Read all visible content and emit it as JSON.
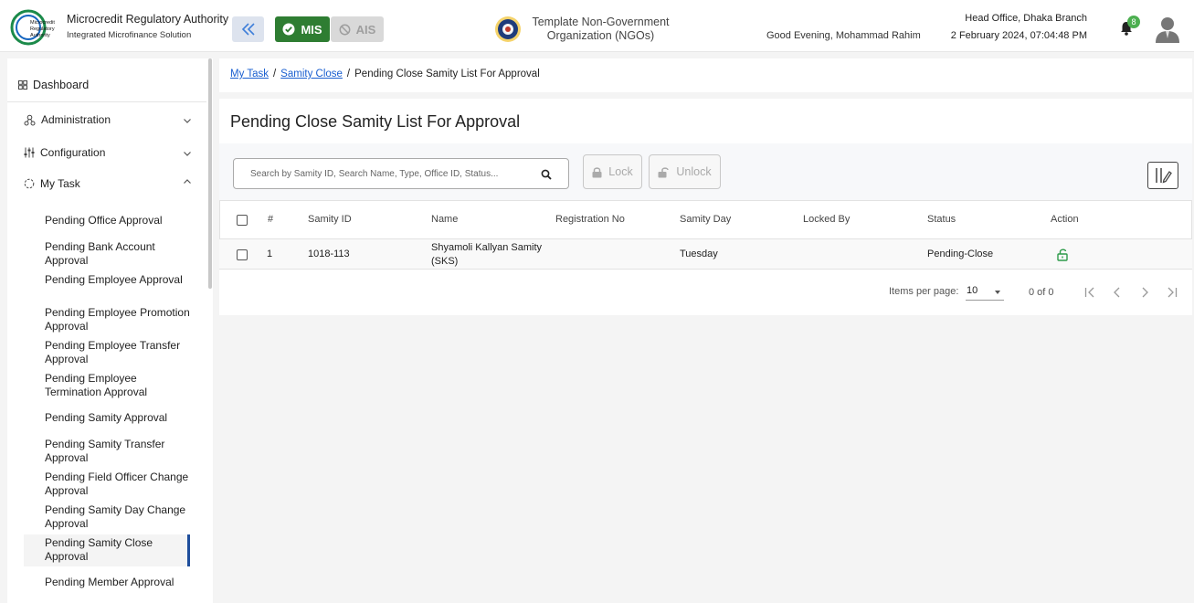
{
  "header": {
    "org_title": "Microcredit Regulatory Authority",
    "org_subtitle": "Integrated Microfinance Solution",
    "logo_text": [
      "Microcredit",
      "Regulatory",
      "Authority"
    ],
    "mis_label": "MIS",
    "ais_label": "AIS",
    "ngo_name": "Template Non-Government Organization (NGOs)",
    "greeting": "Good Evening, Mohammad Rahim",
    "branch": "Head Office, Dhaka Branch",
    "datetime": "2 February 2024, 07:04:48 PM",
    "notification_count": "8",
    "icons": [
      "double-chevron-left-icon",
      "check-circle-icon",
      "ban-icon",
      "bell-icon",
      "user-avatar-icon"
    ],
    "colors": {
      "mis_green": "#2e7d32",
      "badge_green": "#4caf50",
      "collapse_bg": "#dde3ee",
      "link_blue": "#1a5fd0"
    }
  },
  "sidebar": {
    "dashboard": "Dashboard",
    "administration": "Administration",
    "configuration": "Configuration",
    "my_task": "My Task",
    "my_task_items": [
      "Pending Office Approval",
      "Pending Bank Account Approval",
      "Pending Employee Approval",
      "Pending Employee Promotion Approval",
      "Pending Employee Transfer Approval",
      "Pending Employee Termination Approval",
      "Pending Samity Approval",
      "Pending Samity Transfer Approval",
      "Pending Field Officer Change Approval",
      "Pending Samity Day Change Approval",
      "Pending Samity Close Approval",
      "Pending Member Approval"
    ],
    "active_item": "Pending Samity Close Approval",
    "icons": [
      "dashboard-icon",
      "administration-icon",
      "configuration-icon",
      "my-task-icon"
    ]
  },
  "breadcrumb": {
    "items": [
      "My Task",
      "Samity Close",
      "Pending Close Samity List For Approval"
    ],
    "separator": "/"
  },
  "page": {
    "title": "Pending Close Samity List For Approval",
    "search_placeholder": "Search by Samity ID, Search Name, Type, Office ID, Status...",
    "lock_label": "Lock",
    "unlock_label": "Unlock"
  },
  "table": {
    "columns": [
      "#",
      "Samity ID",
      "Name",
      "Registration No",
      "Samity Day",
      "Locked By",
      "Status",
      "Action"
    ],
    "rows": [
      {
        "index": "1",
        "samity_id": "1018-113",
        "name_line1": "Shyamoli Kallyan Samity",
        "name_line2": "(SKS)",
        "registration_no": "",
        "samity_day": "Tuesday",
        "locked_by": "",
        "status": "Pending-Close",
        "action_icon": "unlock-icon"
      }
    ]
  },
  "pagination": {
    "items_label": "Items per page:",
    "items_per_page": "10",
    "range": "0 of 0"
  }
}
